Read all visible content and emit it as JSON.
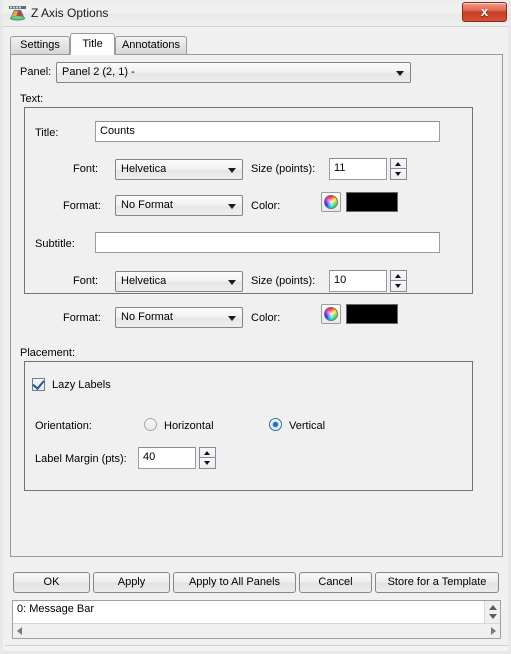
{
  "window": {
    "title": "Z Axis Options",
    "icon": "chart-globe-icon",
    "close_label": "x"
  },
  "tabs": [
    {
      "label": "Settings",
      "active": false
    },
    {
      "label": "Title",
      "active": true
    },
    {
      "label": "Annotations",
      "active": false
    }
  ],
  "panel": {
    "label": "Panel:",
    "selected": "Panel 2 (2, 1)  -"
  },
  "text_group": {
    "caption": "Text:",
    "title": {
      "label": "Title:",
      "value": "Counts",
      "font_label": "Font:",
      "font_value": "Helvetica",
      "size_label": "Size (points):",
      "size_value": "11",
      "format_label": "Format:",
      "format_value": "No Format",
      "color_label": "Color:",
      "color_value": "#000000"
    },
    "subtitle": {
      "label": "Subtitle:",
      "value": "",
      "font_label": "Font:",
      "font_value": "Helvetica",
      "size_label": "Size (points):",
      "size_value": "10",
      "format_label": "Format:",
      "format_value": "No Format",
      "color_label": "Color:",
      "color_value": "#000000"
    }
  },
  "placement_group": {
    "caption": "Placement:",
    "lazy_labels_label": "Lazy Labels",
    "lazy_labels_checked": true,
    "orientation_label": "Orientation:",
    "orientation_options": [
      {
        "label": "Horizontal",
        "selected": false
      },
      {
        "label": "Vertical",
        "selected": true
      }
    ],
    "label_margin_label": "Label Margin (pts):",
    "label_margin_value": "40"
  },
  "buttons": [
    {
      "label": "OK"
    },
    {
      "label": "Apply"
    },
    {
      "label": "Apply to All Panels"
    },
    {
      "label": "Cancel"
    },
    {
      "label": "Store for a Template"
    }
  ],
  "message_bar": {
    "text": "0: Message Bar"
  },
  "colors": {
    "accent_blue": "#1f6fc4",
    "dialog_bg": "#f0f0f0",
    "close_red": "#c93c22"
  }
}
